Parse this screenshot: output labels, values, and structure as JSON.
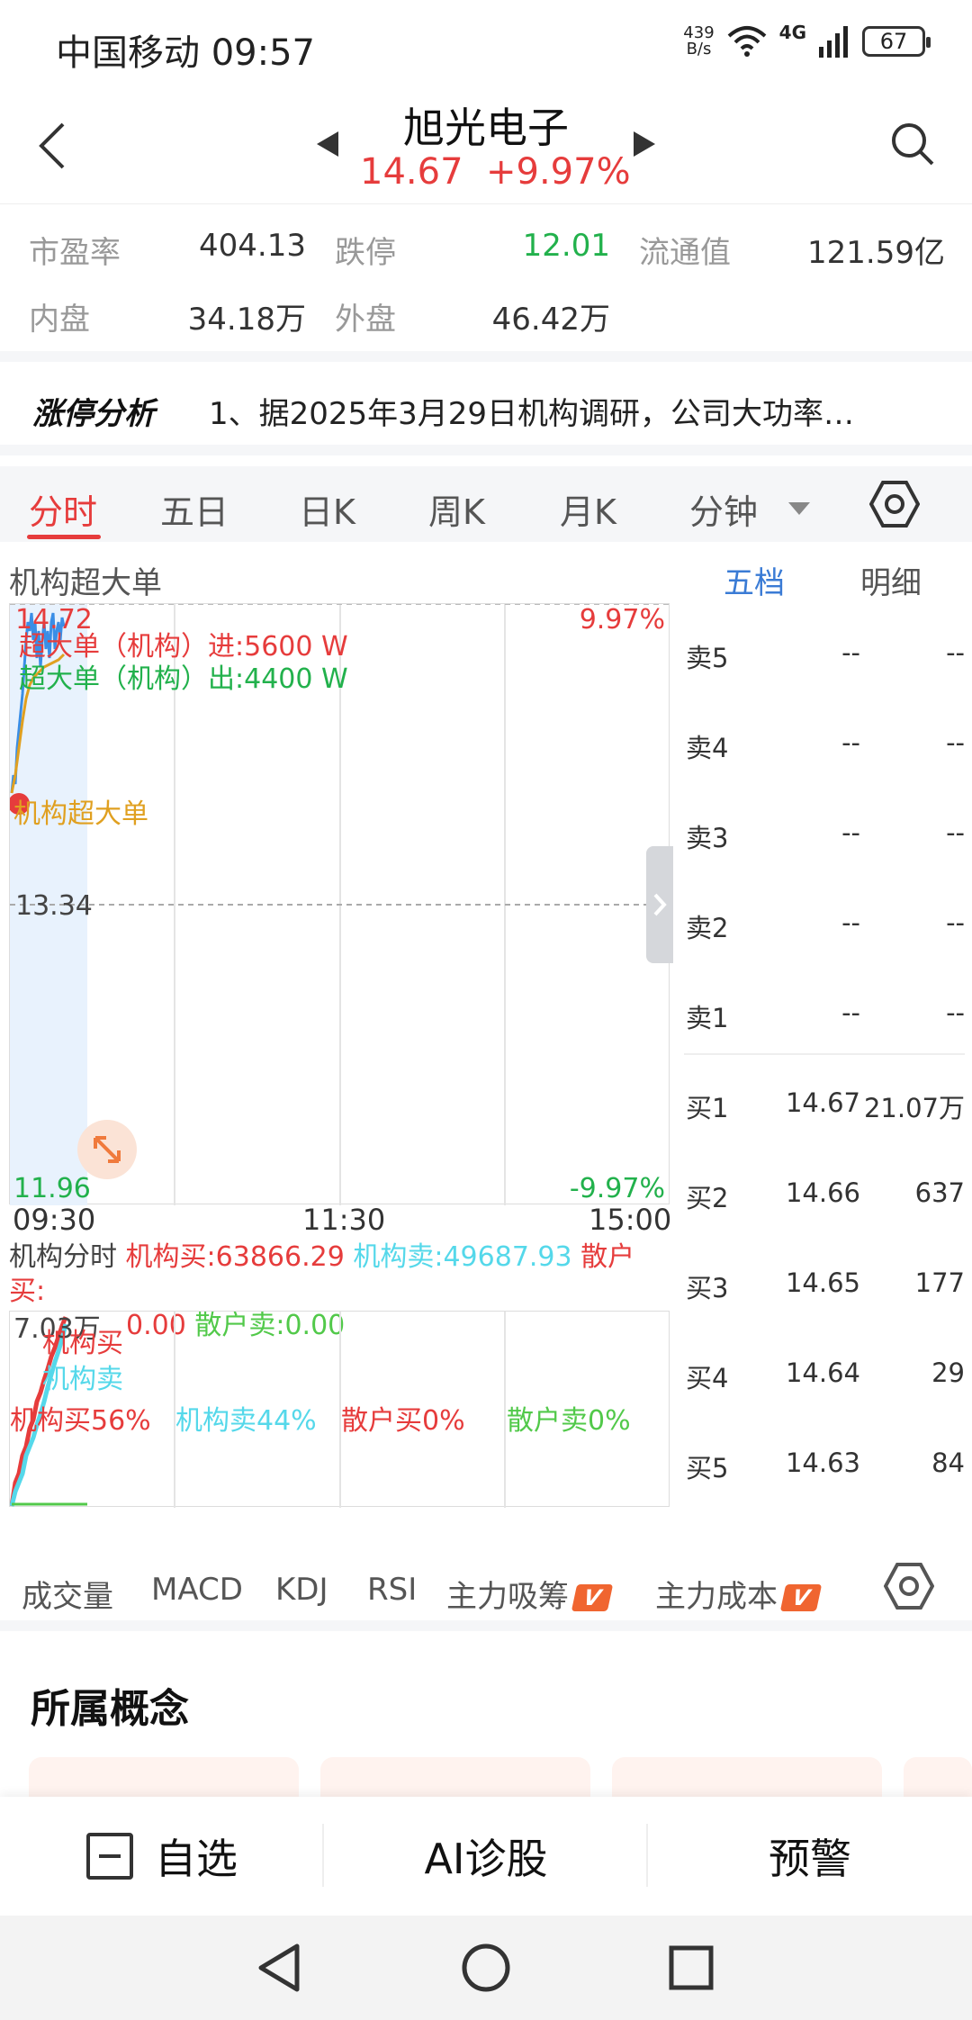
{
  "status_bar": {
    "carrier_time": "中国移动 09:57",
    "net_speed_value": "439",
    "net_speed_unit": "B/s",
    "network": "4G",
    "battery": "67"
  },
  "header": {
    "stock_name": "旭光电子",
    "price": "14.67",
    "change_pct": "+9.97%"
  },
  "quote": {
    "pe_label": "市盈率",
    "pe_value": "404.13",
    "limit_down_label": "跌停",
    "limit_down_value": "12.01",
    "float_cap_label": "流通值",
    "float_cap_value": "121.59亿",
    "inner_label": "内盘",
    "inner_value": "34.18万",
    "outer_label": "外盘",
    "outer_value": "46.42万"
  },
  "analysis": {
    "logo": "涨停分析",
    "text": "1、据2025年3月29日机构调研，公司大功率…"
  },
  "tabs": [
    "分时",
    "五日",
    "日K",
    "周K",
    "月K",
    "分钟"
  ],
  "chart": {
    "title": "机构超大单",
    "side_tabs": [
      "五档",
      "明细"
    ],
    "price_high": "14.72",
    "price_mid": "13.34",
    "price_low": "11.96",
    "pct_high": "9.97%",
    "pct_low": "-9.97%",
    "inst_in": "超大单（机构）进:5600 W",
    "inst_out": "超大单（机构）出:4400 W",
    "marker_label": "机构超大单",
    "times": [
      "09:30",
      "11:30",
      "15:00"
    ],
    "colors": {
      "up": "#e63c3c",
      "down": "#22b14c",
      "price_line": "#3a8ee6",
      "avg_line": "#e0a020"
    }
  },
  "sub_chart": {
    "legend_title": "机构分时",
    "inst_buy": "机构买:63866.29",
    "inst_sell": "机构卖:49687.93",
    "retail_buy": "散户买:",
    "retail_buy_val": "0.00",
    "retail_sell": "散户卖:0.00",
    "axis_top": "7.03万",
    "legend_buy": "机构买",
    "legend_sell": "机构卖",
    "pct_inst_buy": "机构买56%",
    "pct_inst_sell": "机构卖44%",
    "pct_retail_buy": "散户买0%",
    "pct_retail_sell": "散户卖0%"
  },
  "order_book": [
    {
      "label": "卖5",
      "price": "--",
      "vol": "--"
    },
    {
      "label": "卖4",
      "price": "--",
      "vol": "--"
    },
    {
      "label": "卖3",
      "price": "--",
      "vol": "--"
    },
    {
      "label": "卖2",
      "price": "--",
      "vol": "--"
    },
    {
      "label": "卖1",
      "price": "--",
      "vol": "--"
    },
    {
      "label": "买1",
      "price": "14.67",
      "vol": "21.07万"
    },
    {
      "label": "买2",
      "price": "14.66",
      "vol": "637"
    },
    {
      "label": "买3",
      "price": "14.65",
      "vol": "177"
    },
    {
      "label": "买4",
      "price": "14.64",
      "vol": "29"
    },
    {
      "label": "买5",
      "price": "14.63",
      "vol": "84"
    }
  ],
  "indicators": [
    "成交量",
    "MACD",
    "KDJ",
    "RSI",
    "主力吸筹",
    "主力成本"
  ],
  "badge_text": "V",
  "concepts_title": "所属概念",
  "actions": {
    "watchlist": "自选",
    "ai": "AI诊股",
    "alert": "预警"
  }
}
